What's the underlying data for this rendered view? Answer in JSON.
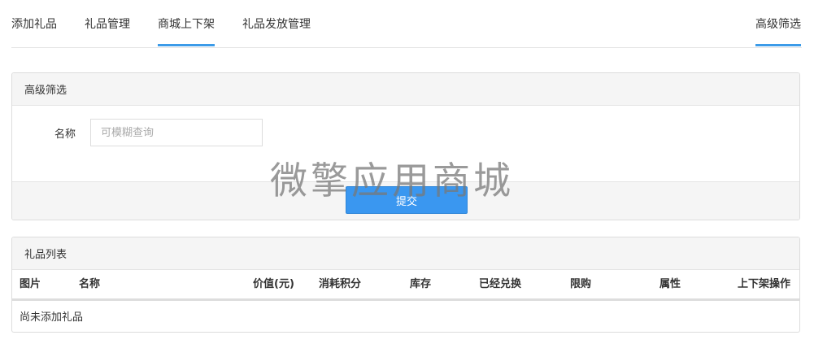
{
  "tabs": [
    {
      "label": "添加礼品",
      "active": false
    },
    {
      "label": "礼品管理",
      "active": false
    },
    {
      "label": "商城上下架",
      "active": true
    },
    {
      "label": "礼品发放管理",
      "active": false
    }
  ],
  "right_tab": {
    "label": "高级筛选",
    "active": true
  },
  "filter": {
    "title": "高级筛选",
    "name_label": "名称",
    "name_placeholder": "可模糊查询",
    "name_value": "",
    "submit_label": "提交"
  },
  "list": {
    "title": "礼品列表",
    "columns": [
      "图片",
      "名称",
      "价值(元)",
      "消耗积分",
      "库存",
      "已经兑换",
      "限购",
      "属性",
      "上下架操作"
    ],
    "empty_text": "尚未添加礼品"
  },
  "watermark": "微擎应用商城",
  "colors": {
    "accent": "#3c9be8",
    "button": "#3a97f0",
    "panel_head": "#f5f5f5"
  }
}
